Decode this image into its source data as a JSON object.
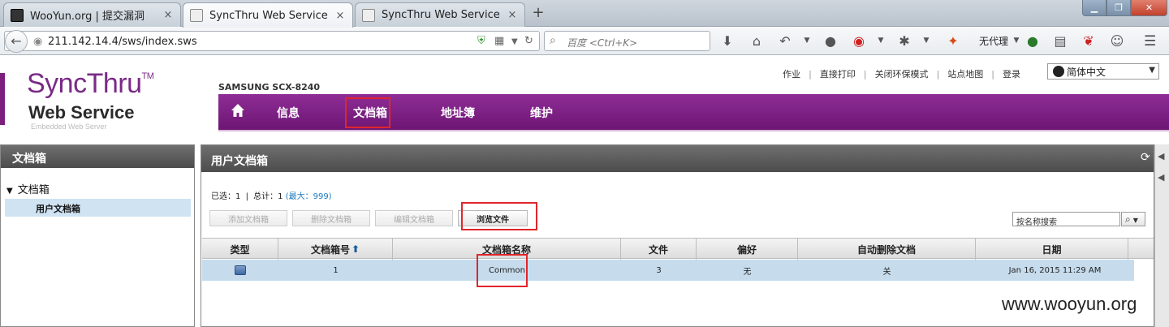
{
  "browser": {
    "tabs": [
      {
        "title": "WooYun.org | 提交漏洞",
        "close": "×"
      },
      {
        "title": "SyncThru Web Service",
        "close": "×"
      },
      {
        "title": "SyncThru Web Service",
        "close": "×"
      }
    ],
    "new_tab": "+",
    "url": "211.142.14.4/sws/index.sws",
    "search_placeholder": "百度 <Ctrl+K>",
    "proxy_label": "无代理"
  },
  "header": {
    "logo_main": "SyncThru",
    "logo_tm": "TM",
    "logo_sub": "Web Service",
    "logo_tag": "Embedded Web Server",
    "model": "SAMSUNG SCX-8240",
    "top_links": [
      "作业",
      "直接打印",
      "关闭环保模式",
      "站点地图",
      "登录"
    ],
    "language": "简体中文"
  },
  "main_nav": {
    "items": [
      "信息",
      "文档箱",
      "地址簿",
      "维护"
    ]
  },
  "left_panel": {
    "title": "文档箱",
    "tree_root": "文档箱",
    "tree_child": "用户文档箱"
  },
  "right_panel": {
    "title": "用户文档箱",
    "summary_selected": "已选：1",
    "summary_sep": "|",
    "summary_total": "总计：1",
    "summary_max": "(最大：999)",
    "buttons": {
      "add": "添加文档箱",
      "delete": "删除文档箱",
      "edit": "编辑文档箱",
      "browse": "浏览文件"
    },
    "search_placeholder": "按名称搜索",
    "columns": [
      "类型",
      "文档箱号",
      "文档箱名称",
      "文件",
      "偏好",
      "自动删除文档",
      "日期"
    ],
    "rows": [
      {
        "number": "1",
        "name": "Common",
        "files": "3",
        "preference": "无",
        "auto_delete": "关",
        "date": "Jan 16, 2015 11:29 AM"
      }
    ]
  },
  "watermark": "www.wooyun.org"
}
